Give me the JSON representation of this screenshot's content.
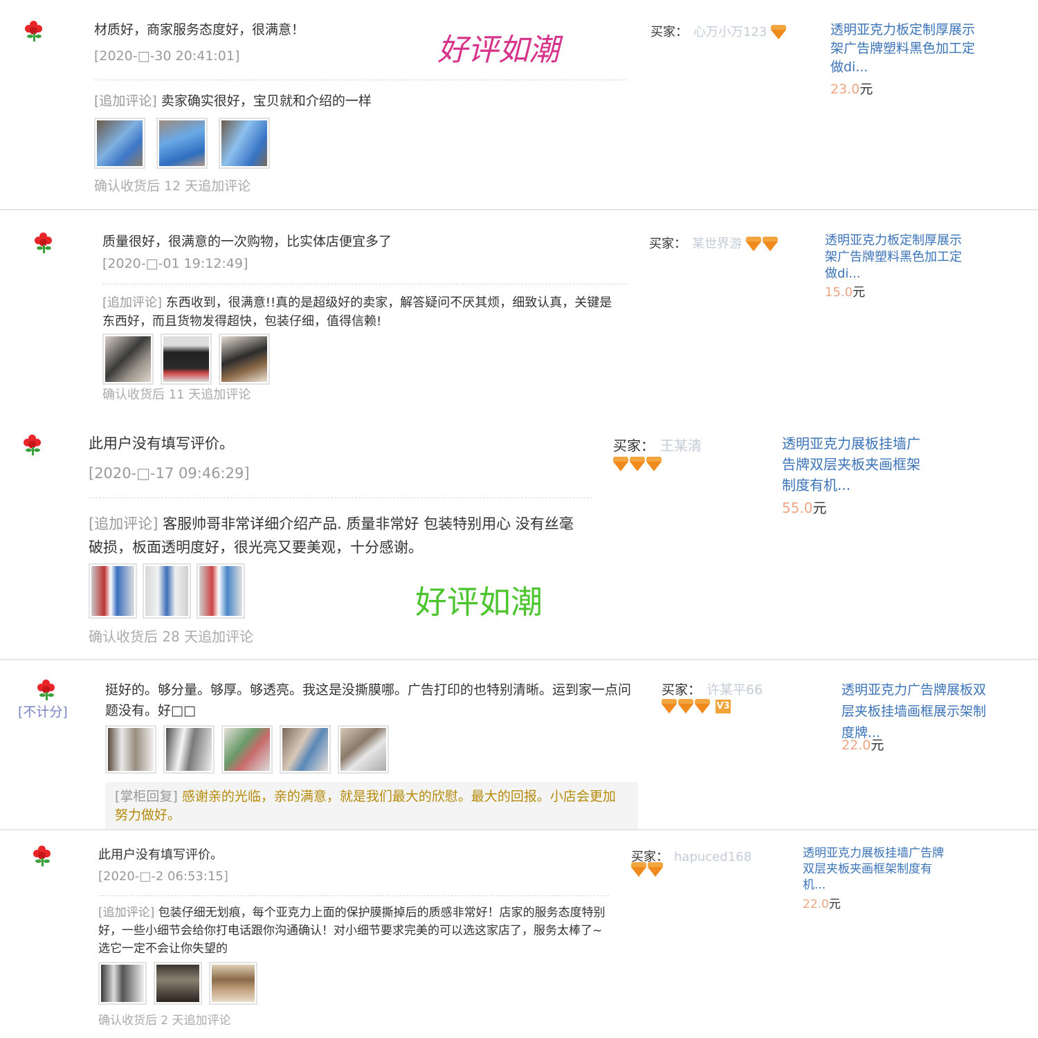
{
  "watermark": {
    "text": "好评如潮"
  },
  "labels": {
    "buyer_prefix": "买家：",
    "append_tag": "[追加评论]",
    "reply_tag": "[掌柜回复]",
    "price_unit": "元",
    "no_count": "[不计分]"
  },
  "reviews": [
    {
      "text": "材质好，商家服务态度好，很满意！",
      "date": "[2020-□-30 20:41:01]",
      "append": "卖家确实很好，宝贝就和介绍的一样",
      "followup": "确认收货后 12 天追加评论",
      "buyer_nick": "心万小万123",
      "gems": 1,
      "product": "透明亚克力板定制厚展示架广告牌塑料黑色加工定做di...",
      "price": "23.0"
    },
    {
      "text": "质量很好，很满意的一次购物，比实体店便宜多了",
      "date": "[2020-□-01 19:12:49]",
      "append": "东西收到，很满意!!真的是超级好的卖家，解答疑问不厌其烦，细致认真，关键是东西好，而且货物发得超快，包装仔细，值得信赖!",
      "followup": "确认收货后 11 天追加评论",
      "buyer_nick": "某世界游",
      "gems": 2,
      "product": "透明亚克力板定制厚展示架广告牌塑料黑色加工定做di...",
      "price": "15.0"
    },
    {
      "text": "此用户没有填写评价。",
      "date": "[2020-□-17 09:46:29]",
      "append": "客服帅哥非常详细介绍产品. 质量非常好 包装特别用心 没有丝毫破损，板面透明度好，很光亮又要美观，十分感谢。",
      "followup": "确认收货后 28 天追加评论",
      "buyer_nick": "王某清",
      "gems": 3,
      "product": "透明亚克力展板挂墙广告牌双层夹板夹画框架制度有机...",
      "price": "55.0"
    },
    {
      "text": "挺好的。够分量。够厚。够透亮。我这是没撕膜哪。广告打印的也特别清晰。运到家一点问题没有。好□□",
      "buyer_nick": "许某平66",
      "gems": 3,
      "vip": "V3",
      "product": "透明亚克力广告牌展板双层夹板挂墙画框展示架制度牌...",
      "price": "22.0",
      "reply": "感谢亲的光临，亲的满意，就是我们最大的欣慰。最大的回报。小店会更加努力做好。"
    },
    {
      "text": "此用户没有填写评价。",
      "date": "[2020-□-2 06:53:15]",
      "append": "包装仔细无划痕，每个亚克力上面的保护膜撕掉后的质感非常好！店家的服务态度特别好，一些小细节会给你打电话跟你沟通确认！对小细节要求完美的可以选这家店了，服务太棒了~选它一定不会让你失望的",
      "followup": "确认收货后 2 天追加评论",
      "buyer_nick": "hapuced168",
      "gems": 2,
      "product": "透明亚克力展板挂墙广告牌双层夹板夹画框架制度有机...",
      "price": "22.0"
    }
  ],
  "colors": {
    "watermark_pink": "#d6338a",
    "watermark_green": "#4cc52e",
    "link": "#3b73b9",
    "gem": "#f08a1c"
  }
}
